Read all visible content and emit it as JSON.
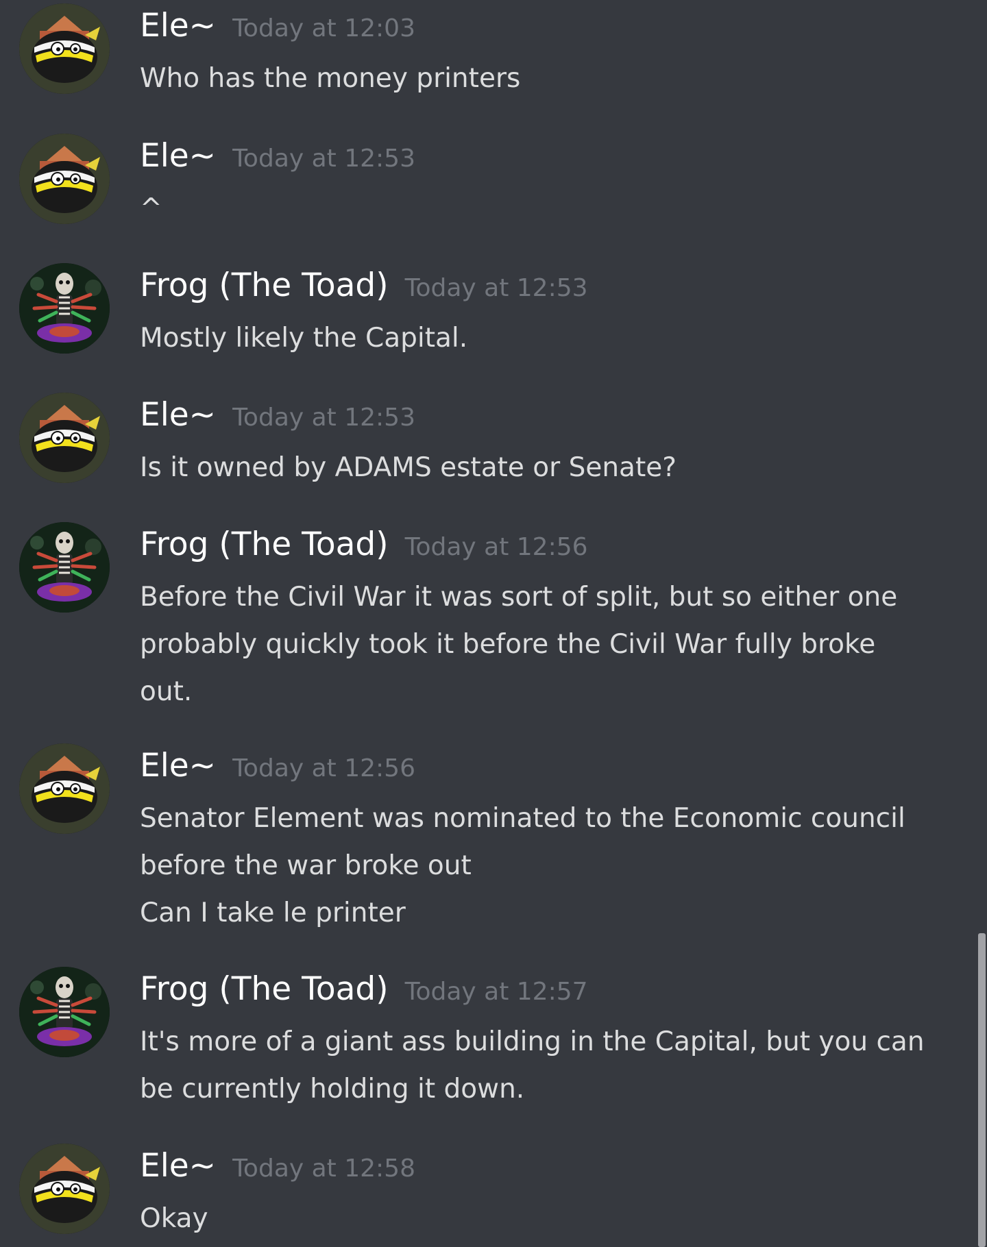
{
  "messages": [
    {
      "author": "Ele~",
      "avatar": "ele-avatar",
      "timestamp": "Today at 12:03",
      "lines": [
        "Who has the money printers"
      ]
    },
    {
      "author": "Ele~",
      "avatar": "ele-avatar",
      "timestamp": "Today at 12:53",
      "lines": [
        "^"
      ]
    },
    {
      "author": "Frog (The Toad)",
      "avatar": "frog-avatar",
      "timestamp": "Today at 12:53",
      "lines": [
        "Mostly likely the Capital."
      ]
    },
    {
      "author": "Ele~",
      "avatar": "ele-avatar",
      "timestamp": "Today at 12:53",
      "lines": [
        "Is it owned by ADAMS estate or Senate?"
      ]
    },
    {
      "author": "Frog (The Toad)",
      "avatar": "frog-avatar",
      "timestamp": "Today at 12:56",
      "lines": [
        "Before the Civil War it was sort of split, but so either one",
        "probably quickly took it before the Civil War fully broke",
        "out."
      ]
    },
    {
      "author": "Ele~",
      "avatar": "ele-avatar",
      "timestamp": "Today at 12:56",
      "lines": [
        "Senator Element was nominated to the Economic council",
        "before the war broke out",
        "Can I take le printer"
      ]
    },
    {
      "author": "Frog (The Toad)",
      "avatar": "frog-avatar",
      "timestamp": "Today at 12:57",
      "lines": [
        "It's more of a giant ass building in the Capital, but you can",
        "be currently holding it down."
      ]
    },
    {
      "author": "Ele~",
      "avatar": "ele-avatar",
      "timestamp": "Today at 12:58",
      "lines": [
        "Okay"
      ]
    }
  ],
  "colors": {
    "background": "#36393f",
    "username": "#ffffff",
    "timestamp": "#72767d",
    "message_text": "#dcddde",
    "scrollbar_thumb": "#a2a3a7"
  }
}
